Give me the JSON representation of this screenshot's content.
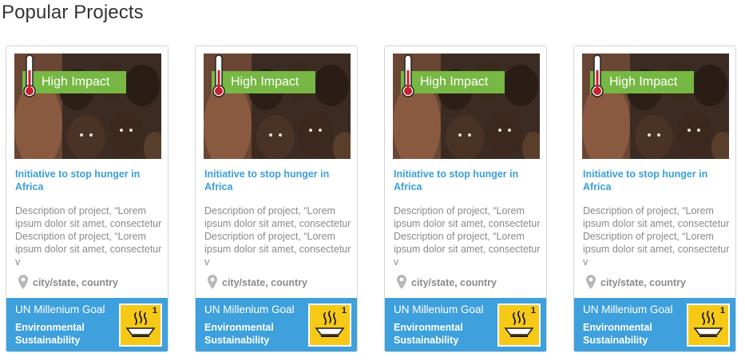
{
  "section": {
    "title": "Popular Projects"
  },
  "cards": [
    {
      "badge": "High Impact",
      "title": "Initiative to stop hunger in Africa",
      "description": "Description of project, “Lorem ipsum dolor sit amet, consectetur Description of project, “Lorem ipsum dolor sit amet, consectetur v",
      "location": "city/state, country",
      "goal_title": "UN Millenium Goal",
      "goal_name": "Environmental Sustainability",
      "goal_number": "1"
    },
    {
      "badge": "High Impact",
      "title": "Initiative to stop hunger in Africa",
      "description": "Description of project, “Lorem ipsum dolor sit amet, consectetur Description of project, “Lorem ipsum dolor sit amet, consectetur v",
      "location": "city/state, country",
      "goal_title": "UN Millenium Goal",
      "goal_name": "Environmental Sustainability",
      "goal_number": "1"
    },
    {
      "badge": "High Impact",
      "title": "Initiative to stop hunger in Africa",
      "description": "Description of project, “Lorem ipsum dolor sit amet, consectetur Description of project, “Lorem ipsum dolor sit amet, consectetur v",
      "location": "city/state, country",
      "goal_title": "UN Millenium Goal",
      "goal_name": "Environmental Sustainability",
      "goal_number": "1"
    },
    {
      "badge": "High Impact",
      "title": "Initiative to stop hunger in Africa",
      "description": "Description of project, “Lorem ipsum dolor sit amet, consectetur Description of project, “Lorem ipsum dolor sit amet, consectetur v",
      "location": "city/state, country",
      "goal_title": "UN Millenium Goal",
      "goal_name": "Environmental Sustainability",
      "goal_number": "1"
    }
  ],
  "icons": {
    "badge_icon": "thermometer-icon",
    "location_icon": "map-pin-icon",
    "goal_icon": "hunger-bowl-icon"
  },
  "colors": {
    "badge": "#76b843",
    "link": "#3a9fd8",
    "footer": "#3ea0dc",
    "goal_icon_bg": "#f6c917"
  }
}
